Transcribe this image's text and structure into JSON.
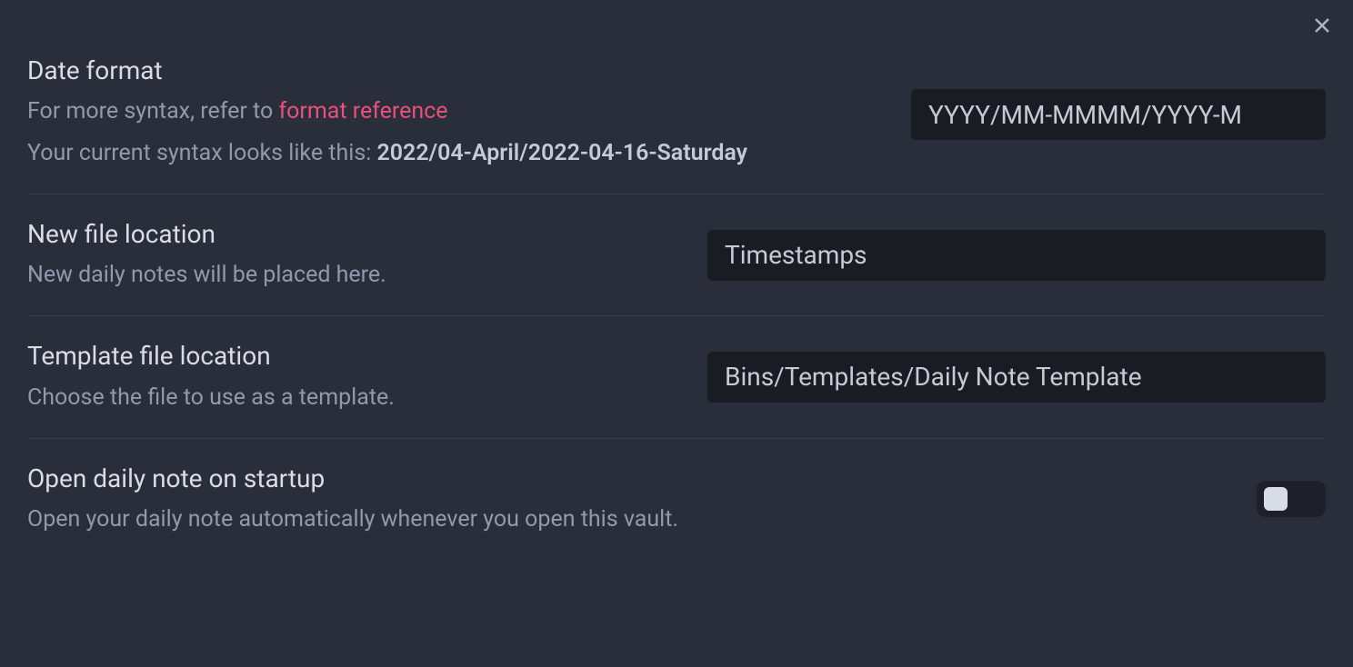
{
  "close_icon": "close",
  "settings": [
    {
      "name": "Date format",
      "description_prefix": "For more syntax, refer to ",
      "link_text": "format reference",
      "preview_prefix": "Your current syntax looks like this: ",
      "preview_value": "2022/04-April/2022-04-16-Saturday",
      "input_value": "YYYY/MM-MMMM/YYYY-M"
    },
    {
      "name": "New file location",
      "description": "New daily notes will be placed here.",
      "input_value": "Timestamps"
    },
    {
      "name": "Template file location",
      "description": "Choose the file to use as a template.",
      "input_value": "Bins/Templates/Daily Note Template"
    },
    {
      "name": "Open daily note on startup",
      "description": "Open your daily note automatically whenever you open this vault.",
      "toggle_on": false
    }
  ]
}
